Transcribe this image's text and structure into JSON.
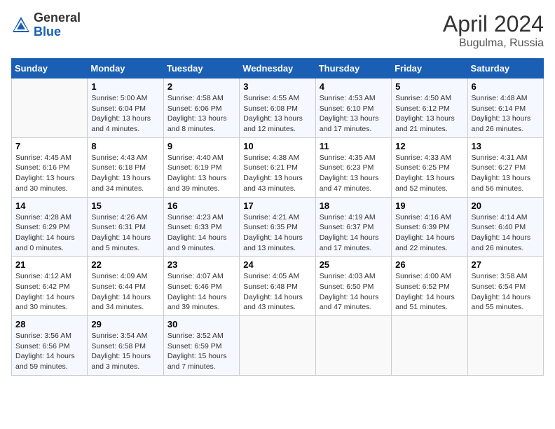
{
  "header": {
    "logo_general": "General",
    "logo_blue": "Blue",
    "month": "April 2024",
    "location": "Bugulma, Russia"
  },
  "weekdays": [
    "Sunday",
    "Monday",
    "Tuesday",
    "Wednesday",
    "Thursday",
    "Friday",
    "Saturday"
  ],
  "weeks": [
    [
      {
        "day": "",
        "info": ""
      },
      {
        "day": "1",
        "info": "Sunrise: 5:00 AM\nSunset: 6:04 PM\nDaylight: 13 hours\nand 4 minutes."
      },
      {
        "day": "2",
        "info": "Sunrise: 4:58 AM\nSunset: 6:06 PM\nDaylight: 13 hours\nand 8 minutes."
      },
      {
        "day": "3",
        "info": "Sunrise: 4:55 AM\nSunset: 6:08 PM\nDaylight: 13 hours\nand 12 minutes."
      },
      {
        "day": "4",
        "info": "Sunrise: 4:53 AM\nSunset: 6:10 PM\nDaylight: 13 hours\nand 17 minutes."
      },
      {
        "day": "5",
        "info": "Sunrise: 4:50 AM\nSunset: 6:12 PM\nDaylight: 13 hours\nand 21 minutes."
      },
      {
        "day": "6",
        "info": "Sunrise: 4:48 AM\nSunset: 6:14 PM\nDaylight: 13 hours\nand 26 minutes."
      }
    ],
    [
      {
        "day": "7",
        "info": "Sunrise: 4:45 AM\nSunset: 6:16 PM\nDaylight: 13 hours\nand 30 minutes."
      },
      {
        "day": "8",
        "info": "Sunrise: 4:43 AM\nSunset: 6:18 PM\nDaylight: 13 hours\nand 34 minutes."
      },
      {
        "day": "9",
        "info": "Sunrise: 4:40 AM\nSunset: 6:19 PM\nDaylight: 13 hours\nand 39 minutes."
      },
      {
        "day": "10",
        "info": "Sunrise: 4:38 AM\nSunset: 6:21 PM\nDaylight: 13 hours\nand 43 minutes."
      },
      {
        "day": "11",
        "info": "Sunrise: 4:35 AM\nSunset: 6:23 PM\nDaylight: 13 hours\nand 47 minutes."
      },
      {
        "day": "12",
        "info": "Sunrise: 4:33 AM\nSunset: 6:25 PM\nDaylight: 13 hours\nand 52 minutes."
      },
      {
        "day": "13",
        "info": "Sunrise: 4:31 AM\nSunset: 6:27 PM\nDaylight: 13 hours\nand 56 minutes."
      }
    ],
    [
      {
        "day": "14",
        "info": "Sunrise: 4:28 AM\nSunset: 6:29 PM\nDaylight: 14 hours\nand 0 minutes."
      },
      {
        "day": "15",
        "info": "Sunrise: 4:26 AM\nSunset: 6:31 PM\nDaylight: 14 hours\nand 5 minutes."
      },
      {
        "day": "16",
        "info": "Sunrise: 4:23 AM\nSunset: 6:33 PM\nDaylight: 14 hours\nand 9 minutes."
      },
      {
        "day": "17",
        "info": "Sunrise: 4:21 AM\nSunset: 6:35 PM\nDaylight: 14 hours\nand 13 minutes."
      },
      {
        "day": "18",
        "info": "Sunrise: 4:19 AM\nSunset: 6:37 PM\nDaylight: 14 hours\nand 17 minutes."
      },
      {
        "day": "19",
        "info": "Sunrise: 4:16 AM\nSunset: 6:39 PM\nDaylight: 14 hours\nand 22 minutes."
      },
      {
        "day": "20",
        "info": "Sunrise: 4:14 AM\nSunset: 6:40 PM\nDaylight: 14 hours\nand 26 minutes."
      }
    ],
    [
      {
        "day": "21",
        "info": "Sunrise: 4:12 AM\nSunset: 6:42 PM\nDaylight: 14 hours\nand 30 minutes."
      },
      {
        "day": "22",
        "info": "Sunrise: 4:09 AM\nSunset: 6:44 PM\nDaylight: 14 hours\nand 34 minutes."
      },
      {
        "day": "23",
        "info": "Sunrise: 4:07 AM\nSunset: 6:46 PM\nDaylight: 14 hours\nand 39 minutes."
      },
      {
        "day": "24",
        "info": "Sunrise: 4:05 AM\nSunset: 6:48 PM\nDaylight: 14 hours\nand 43 minutes."
      },
      {
        "day": "25",
        "info": "Sunrise: 4:03 AM\nSunset: 6:50 PM\nDaylight: 14 hours\nand 47 minutes."
      },
      {
        "day": "26",
        "info": "Sunrise: 4:00 AM\nSunset: 6:52 PM\nDaylight: 14 hours\nand 51 minutes."
      },
      {
        "day": "27",
        "info": "Sunrise: 3:58 AM\nSunset: 6:54 PM\nDaylight: 14 hours\nand 55 minutes."
      }
    ],
    [
      {
        "day": "28",
        "info": "Sunrise: 3:56 AM\nSunset: 6:56 PM\nDaylight: 14 hours\nand 59 minutes."
      },
      {
        "day": "29",
        "info": "Sunrise: 3:54 AM\nSunset: 6:58 PM\nDaylight: 15 hours\nand 3 minutes."
      },
      {
        "day": "30",
        "info": "Sunrise: 3:52 AM\nSunset: 6:59 PM\nDaylight: 15 hours\nand 7 minutes."
      },
      {
        "day": "",
        "info": ""
      },
      {
        "day": "",
        "info": ""
      },
      {
        "day": "",
        "info": ""
      },
      {
        "day": "",
        "info": ""
      }
    ]
  ]
}
